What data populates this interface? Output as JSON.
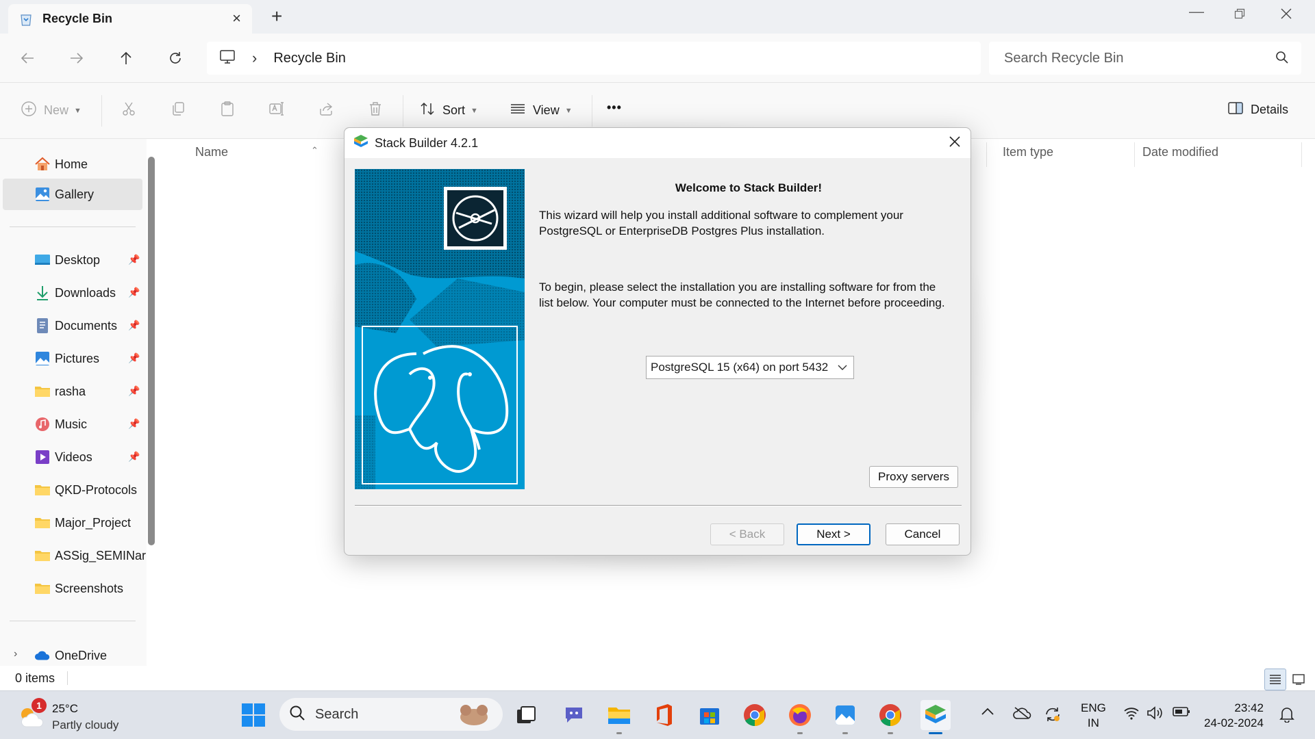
{
  "window": {
    "tab_title": "Recycle Bin",
    "new_tab_symbol": "+",
    "close_tab_symbol": "×"
  },
  "address": {
    "breadcrumb": "Recycle Bin",
    "search_placeholder": "Search Recycle Bin"
  },
  "toolbar": {
    "new_label": "New",
    "sort_label": "Sort",
    "view_label": "View",
    "more_label": "•••",
    "details_label": "Details"
  },
  "sidebar": {
    "items": [
      {
        "label": "Home",
        "icon": "home-icon"
      },
      {
        "label": "Gallery",
        "icon": "gallery-icon"
      },
      {
        "label": "Desktop",
        "icon": "desktop-icon"
      },
      {
        "label": "Downloads",
        "icon": "downloads-icon"
      },
      {
        "label": "Documents",
        "icon": "documents-icon"
      },
      {
        "label": "Pictures",
        "icon": "pictures-icon"
      },
      {
        "label": "rasha",
        "icon": "folder-icon"
      },
      {
        "label": "Music",
        "icon": "music-icon"
      },
      {
        "label": "Videos",
        "icon": "videos-icon"
      },
      {
        "label": "QKD-Protocols",
        "icon": "folder-icon"
      },
      {
        "label": "Major_Project",
        "icon": "folder-icon"
      },
      {
        "label": "ASSig_SEMINar",
        "icon": "folder-icon"
      },
      {
        "label": "Screenshots",
        "icon": "folder-icon"
      },
      {
        "label": "OneDrive",
        "icon": "onedrive-icon"
      }
    ]
  },
  "columns": {
    "name": "Name",
    "item_type": "Item type",
    "date_modified": "Date modified"
  },
  "status": {
    "items_count": "0 items"
  },
  "dialog": {
    "title": "Stack Builder 4.2.1",
    "heading": "Welcome to Stack Builder!",
    "intro": "This wizard will help you install additional software to complement your PostgreSQL or EnterpriseDB Postgres Plus installation.",
    "instructions": "To begin, please select the installation you are installing software for from the list below. Your computer must be connected to the Internet before proceeding.",
    "installation_selected": "PostgreSQL 15 (x64) on port 5432",
    "proxy_button": "Proxy servers",
    "back_button": "< Back",
    "next_button": "Next >",
    "cancel_button": "Cancel"
  },
  "taskbar": {
    "weather_temp": "25°C",
    "weather_condition": "Partly cloudy",
    "weather_badge": "1",
    "search_label": "Search",
    "language_line1": "ENG",
    "language_line2": "IN",
    "time": "23:42",
    "date": "24-02-2024"
  },
  "colors": {
    "accent": "#0067c0",
    "banner_blue": "#009ad2",
    "folder_yellow": "#f4c542"
  }
}
